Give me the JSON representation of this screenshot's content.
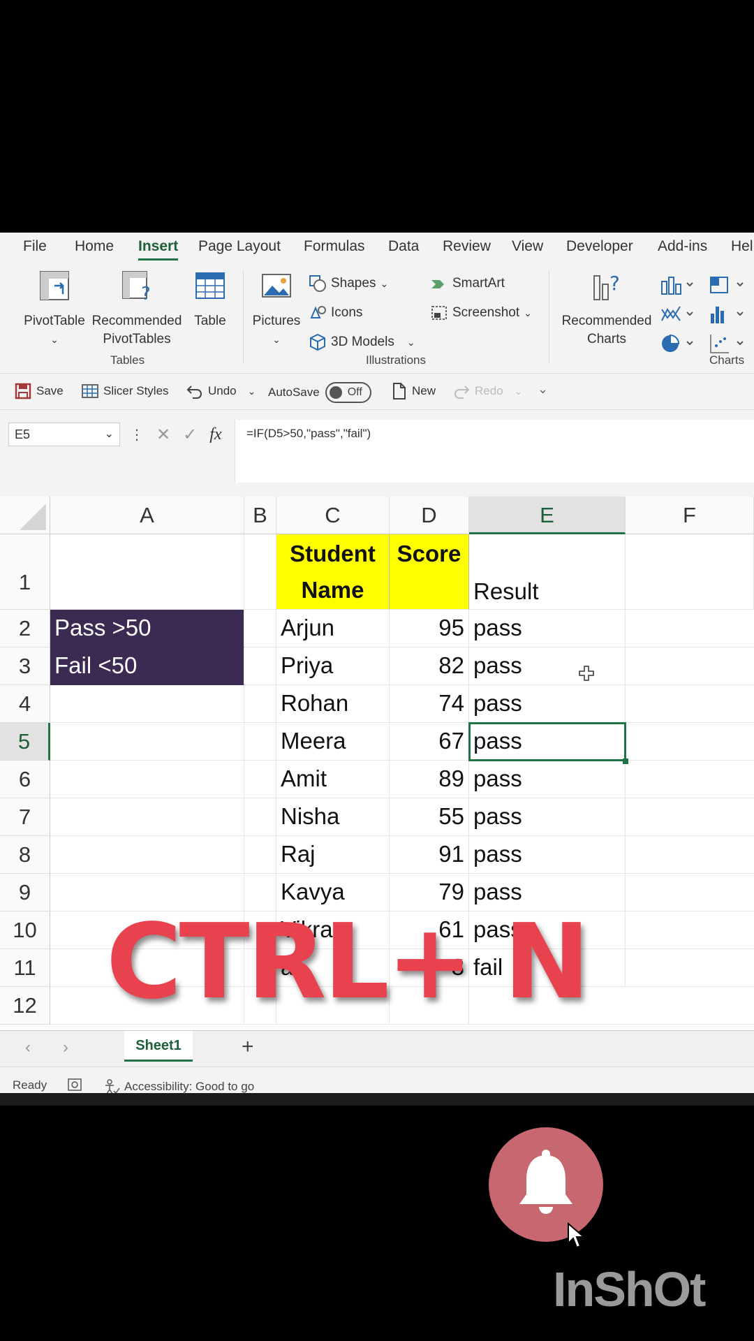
{
  "menu": {
    "tabs": [
      "File",
      "Home",
      "Insert",
      "Page Layout",
      "Formulas",
      "Data",
      "Review",
      "View",
      "Developer",
      "Add-ins",
      "Hel"
    ],
    "active": "Insert"
  },
  "ribbon": {
    "tables": {
      "pivottable": "PivotTable",
      "recommended_line1": "Recommended",
      "recommended_line2": "PivotTables",
      "table": "Table",
      "group": "Tables"
    },
    "illustrations": {
      "pictures": "Pictures",
      "shapes": "Shapes",
      "icons": "Icons",
      "models": "3D Models",
      "smartart": "SmartArt",
      "screenshot": "Screenshot",
      "group": "Illustrations"
    },
    "charts": {
      "recommended_line1": "Recommended",
      "recommended_line2": "Charts",
      "group": "Charts"
    }
  },
  "qat": {
    "save": "Save",
    "slicer": "Slicer Styles",
    "undo": "Undo",
    "autosave": "AutoSave",
    "toggle": "Off",
    "new": "New",
    "redo": "Redo"
  },
  "formula": {
    "namebox": "E5",
    "fx": "fx",
    "text": "=IF(D5>50,\"pass\",\"fail\")"
  },
  "grid": {
    "columns": [
      "A",
      "B",
      "C",
      "D",
      "E",
      "F"
    ],
    "rows": [
      "1",
      "2",
      "3",
      "4",
      "5",
      "6",
      "7",
      "8",
      "9",
      "10",
      "11",
      "12"
    ],
    "header_name": "Student Name",
    "header_score": "Score",
    "header_result": "Result",
    "a2": "Pass >50",
    "a3": "Fail <50",
    "names": [
      "Arjun",
      "Priya",
      "Rohan",
      "Meera",
      "Amit",
      "Nisha",
      "Raj",
      "Kavya",
      "Vikram",
      "al"
    ],
    "scores": [
      "95",
      "82",
      "74",
      "67",
      "89",
      "55",
      "91",
      "79",
      "61",
      "3"
    ],
    "results": [
      "pass",
      "pass",
      "pass",
      "pass",
      "pass",
      "pass",
      "pass",
      "pass",
      "pass",
      "fail"
    ]
  },
  "sheets": {
    "active": "Sheet1",
    "add": "+"
  },
  "status": {
    "ready": "Ready",
    "accessibility": "Accessibility: Good to go"
  },
  "overlay": {
    "shortcut": "CTRL+ N",
    "brand": "InShOt"
  },
  "colors": {
    "accent": "#217346",
    "header_yellow": "#ffff00",
    "dark_fill": "#3b2a52",
    "overlay_red": "#e9424f"
  }
}
